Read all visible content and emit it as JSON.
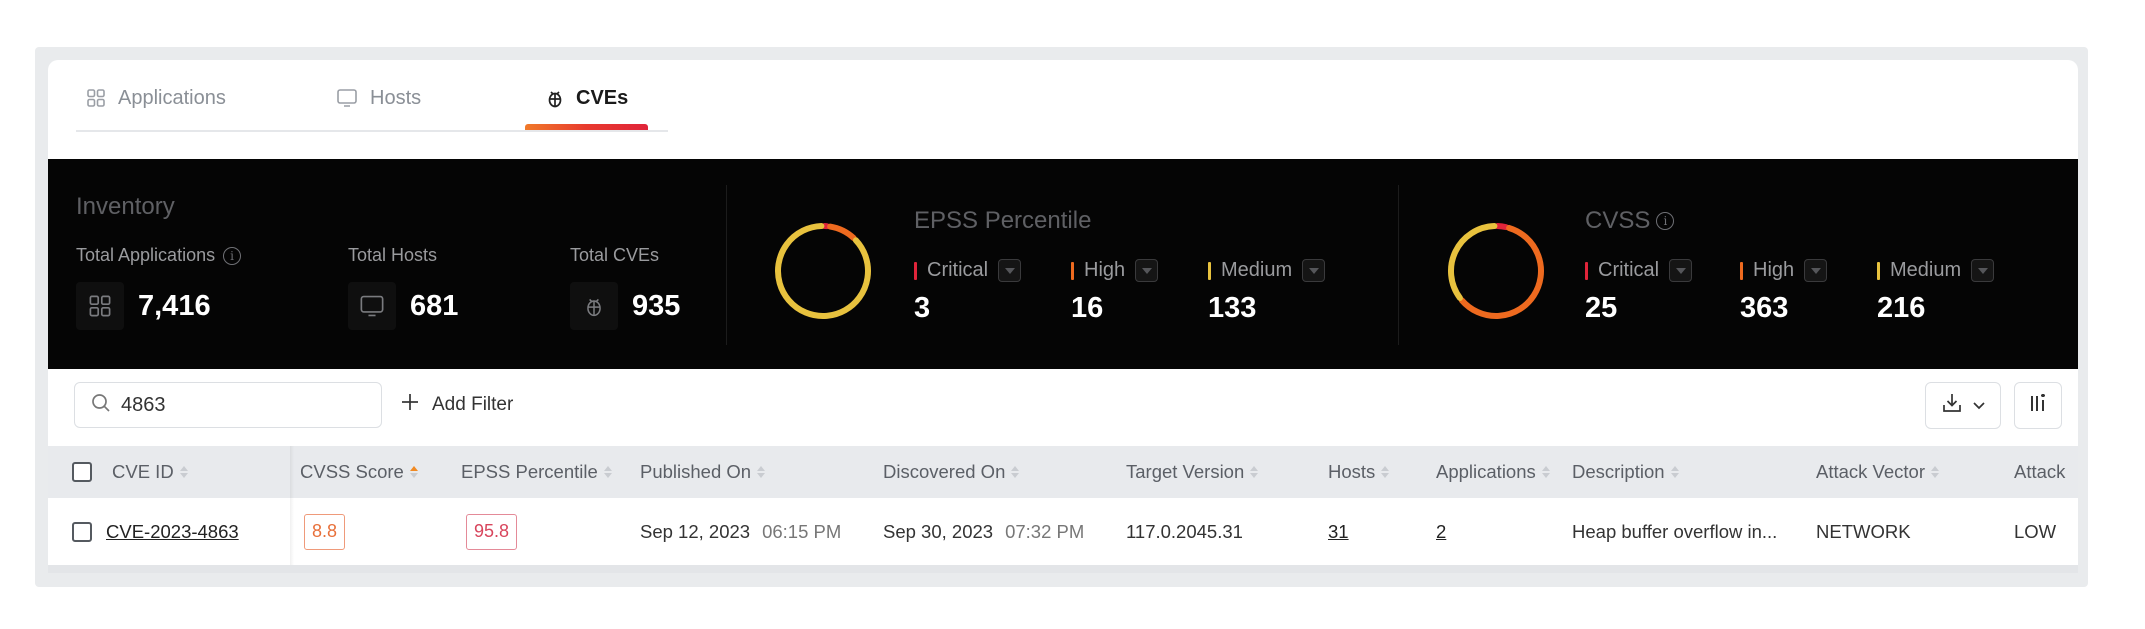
{
  "tabs": [
    {
      "label": "Applications",
      "icon": "grid-icon",
      "active": false
    },
    {
      "label": "Hosts",
      "icon": "monitor-icon",
      "active": false
    },
    {
      "label": "CVEs",
      "icon": "bug-icon",
      "active": true
    }
  ],
  "inventory": {
    "title": "Inventory",
    "cards": [
      {
        "label": "Total Applications",
        "value": "7,416",
        "icon": "grid-icon",
        "has_info": true
      },
      {
        "label": "Total Hosts",
        "value": "681",
        "icon": "monitor-icon",
        "has_info": false
      },
      {
        "label": "Total CVEs",
        "value": "935",
        "icon": "bug-icon",
        "has_info": false
      }
    ]
  },
  "colors": {
    "critical": "#e0243a",
    "high": "#ee6a1f",
    "medium": "#e8c23e",
    "accent": "#f08a24"
  },
  "epss": {
    "title": "EPSS Percentile",
    "severities": [
      {
        "label": "Critical",
        "value": "3",
        "count": 3,
        "color": "#e0243a"
      },
      {
        "label": "High",
        "value": "16",
        "count": 16,
        "color": "#ee6a1f"
      },
      {
        "label": "Medium",
        "value": "133",
        "count": 133,
        "color": "#e8c23e"
      }
    ]
  },
  "cvss": {
    "title": "CVSS",
    "has_info": true,
    "severities": [
      {
        "label": "Critical",
        "value": "25",
        "count": 25,
        "color": "#e0243a"
      },
      {
        "label": "High",
        "value": "363",
        "count": 363,
        "color": "#ee6a1f"
      },
      {
        "label": "Medium",
        "value": "216",
        "count": 216,
        "color": "#e8c23e"
      }
    ]
  },
  "toolbar": {
    "search_value": "4863",
    "search_placeholder": "Search",
    "add_filter_label": "Add Filter",
    "download_icon": "download-icon",
    "columns_icon": "columns-settings-icon"
  },
  "table": {
    "columns": [
      {
        "label": "CVE ID",
        "sort": "none"
      },
      {
        "label": "CVSS Score",
        "sort": "asc"
      },
      {
        "label": "EPSS Percentile",
        "sort": "none"
      },
      {
        "label": "Published On",
        "sort": "none"
      },
      {
        "label": "Discovered On",
        "sort": "none"
      },
      {
        "label": "Target Version",
        "sort": "none"
      },
      {
        "label": "Hosts",
        "sort": "none"
      },
      {
        "label": "Applications",
        "sort": "none"
      },
      {
        "label": "Description",
        "sort": "none"
      },
      {
        "label": "Attack Vector",
        "sort": "none"
      },
      {
        "label": "Attack",
        "sort": "none"
      }
    ],
    "rows": [
      {
        "cve_id": "CVE-2023-4863",
        "cvss_score": "8.8",
        "epss_percentile": "95.8",
        "published_date": "Sep 12, 2023",
        "published_time": "06:15 PM",
        "discovered_date": "Sep 30, 2023",
        "discovered_time": "07:32 PM",
        "target_version": "117.0.2045.31",
        "hosts": "31",
        "applications": "2",
        "description": "Heap buffer overflow in...",
        "attack_vector": "NETWORK",
        "attack_complexity": "LOW"
      }
    ]
  }
}
